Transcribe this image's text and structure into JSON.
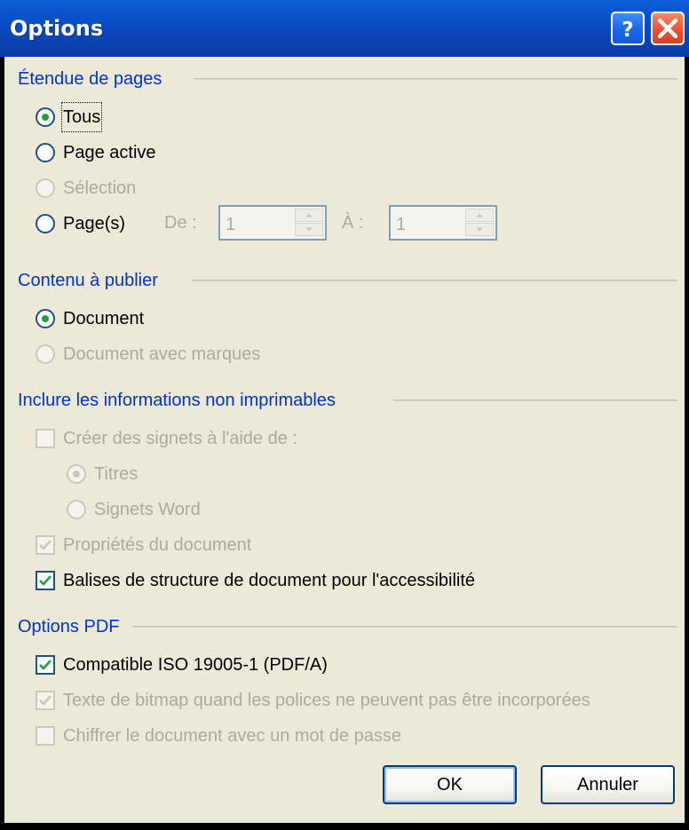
{
  "window": {
    "title": "Options",
    "help_glyph": "?",
    "close_glyph": "✕"
  },
  "groups": {
    "page_range": {
      "title": "Étendue de pages",
      "all": "Tous",
      "active_page": "Page active",
      "selection": "Sélection",
      "pages": "Page(s)",
      "from_label": "De :",
      "from_value": "1",
      "to_label": "À :",
      "to_value": "1"
    },
    "content": {
      "title": "Contenu à publier",
      "document": "Document",
      "document_markup": "Document avec marques"
    },
    "nonprint": {
      "title": "Inclure les informations non imprimables",
      "bookmarks": "Créer des signets à l'aide de :",
      "headings": "Titres",
      "word_bookmarks": "Signets Word",
      "doc_properties": "Propriétés du document",
      "structure_tags": "Balises de structure de document pour l'accessibilité"
    },
    "pdf": {
      "title": "Options PDF",
      "iso": "Compatible ISO 19005-1 (PDF/A)",
      "bitmap": "Texte de bitmap quand les polices ne peuvent pas être incorporées",
      "encrypt": "Chiffrer le document avec un mot de passe"
    }
  },
  "buttons": {
    "ok": "OK",
    "cancel": "Annuler"
  },
  "state": {
    "page_range": "Tous",
    "content": "Document",
    "headings_selected": true,
    "doc_properties_checked": true,
    "structure_tags_checked": true,
    "iso_checked": true,
    "bitmap_checked": true,
    "encrypt_checked": false,
    "bookmarks_checked": false
  },
  "colors": {
    "titlebar": "#0a4fc6",
    "group_title": "#0033c9",
    "dialog_bg": "#ece9d8",
    "check_green": "#20a038",
    "disabled_text": "#acaa99"
  },
  "icons": {
    "help": "help-icon",
    "close": "close-icon",
    "spin_up": "spin-up-icon",
    "spin_down": "spin-down-icon"
  }
}
